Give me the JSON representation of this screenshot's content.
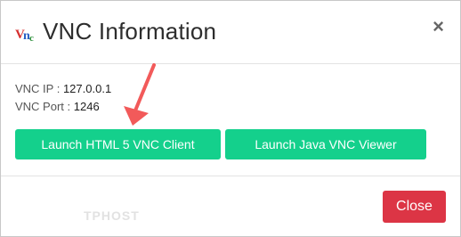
{
  "dialog": {
    "title": "VNC Information",
    "close_symbol": "×"
  },
  "info": {
    "ip_label": "VNC IP : ",
    "ip_value": "127.0.0.1",
    "port_label": "VNC Port : ",
    "port_value": "1246"
  },
  "buttons": {
    "html5_label": "Launch HTML 5 VNC Client",
    "java_label": "Launch Java VNC Viewer",
    "close_label": "Close"
  },
  "footer": {
    "watermark": "TPHOST"
  },
  "colors": {
    "primary_green": "#14d08c",
    "danger_red": "#dc3545",
    "arrow_red": "#f25a5a"
  },
  "icons": {
    "logo": "vnc-logo-icon",
    "close": "close-icon",
    "annotation": "annotation-arrow-icon"
  }
}
